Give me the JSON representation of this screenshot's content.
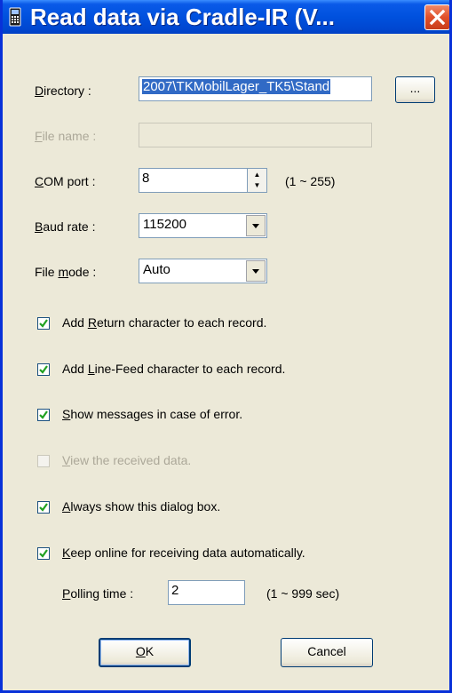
{
  "window": {
    "title": "Read data via Cradle-IR (V..."
  },
  "fields": {
    "directory": {
      "label_pre": "",
      "label_key": "D",
      "label_post": "irectory :",
      "value": "2007\\TKMobilLager_TK5\\Stand",
      "browse_label": "..."
    },
    "file_name": {
      "label_key": "F",
      "label_post": "ile name :",
      "value": ""
    },
    "com_port": {
      "label_key": "C",
      "label_post": "OM port :",
      "value": "8",
      "range": "(1 ~ 255)"
    },
    "baud_rate": {
      "label_key": "B",
      "label_post": "aud rate :",
      "value": "115200"
    },
    "file_mode": {
      "label_pre": "File ",
      "label_key": "m",
      "label_post": "ode :",
      "value": "Auto"
    }
  },
  "options": [
    {
      "pre": "Add ",
      "key": "R",
      "post": "eturn character to each record.",
      "checked": true,
      "enabled": true
    },
    {
      "pre": "Add ",
      "key": "L",
      "post": "ine-Feed character to each record.",
      "checked": true,
      "enabled": true
    },
    {
      "pre": "",
      "key": "S",
      "post": "how messages in case of error.",
      "checked": true,
      "enabled": true
    },
    {
      "pre": "",
      "key": "V",
      "post": "iew the received data.",
      "checked": false,
      "enabled": false
    },
    {
      "pre": "",
      "key": "A",
      "post": "lways show this dialog box.",
      "checked": true,
      "enabled": true
    },
    {
      "pre": "",
      "key": "K",
      "post": "eep online for receiving data automatically.",
      "checked": true,
      "enabled": true
    }
  ],
  "polling": {
    "label_key": "P",
    "label_post": "olling time :",
    "value": "2",
    "range": "(1 ~ 999 sec)"
  },
  "buttons": {
    "ok_key": "O",
    "ok_post": "K",
    "cancel": "Cancel"
  }
}
